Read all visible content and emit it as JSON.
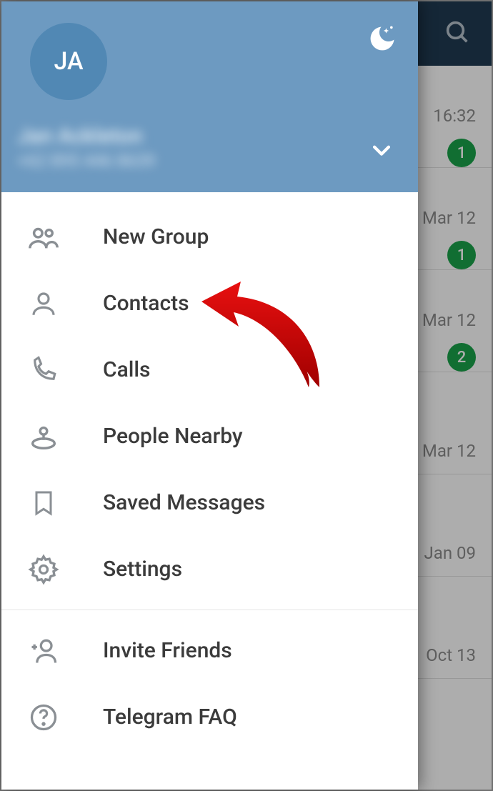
{
  "header": {
    "avatar_initials": "JA",
    "user_name": "Jan Ackleton",
    "user_phone": "+62 895 446 8639"
  },
  "menu": {
    "new_group": "New Group",
    "contacts": "Contacts",
    "calls": "Calls",
    "people_nearby": "People Nearby",
    "saved_messages": "Saved Messages",
    "settings": "Settings",
    "invite_friends": "Invite Friends",
    "telegram_faq": "Telegram FAQ"
  },
  "chats": [
    {
      "time": "16:32",
      "badge": "1"
    },
    {
      "time": "Mar 12",
      "badge": "1"
    },
    {
      "time": "Mar 12",
      "badge": "2"
    },
    {
      "time": "Mar 12",
      "badge": ""
    },
    {
      "time": "Jan 09",
      "badge": ""
    },
    {
      "time": "Oct 13",
      "badge": ""
    }
  ]
}
